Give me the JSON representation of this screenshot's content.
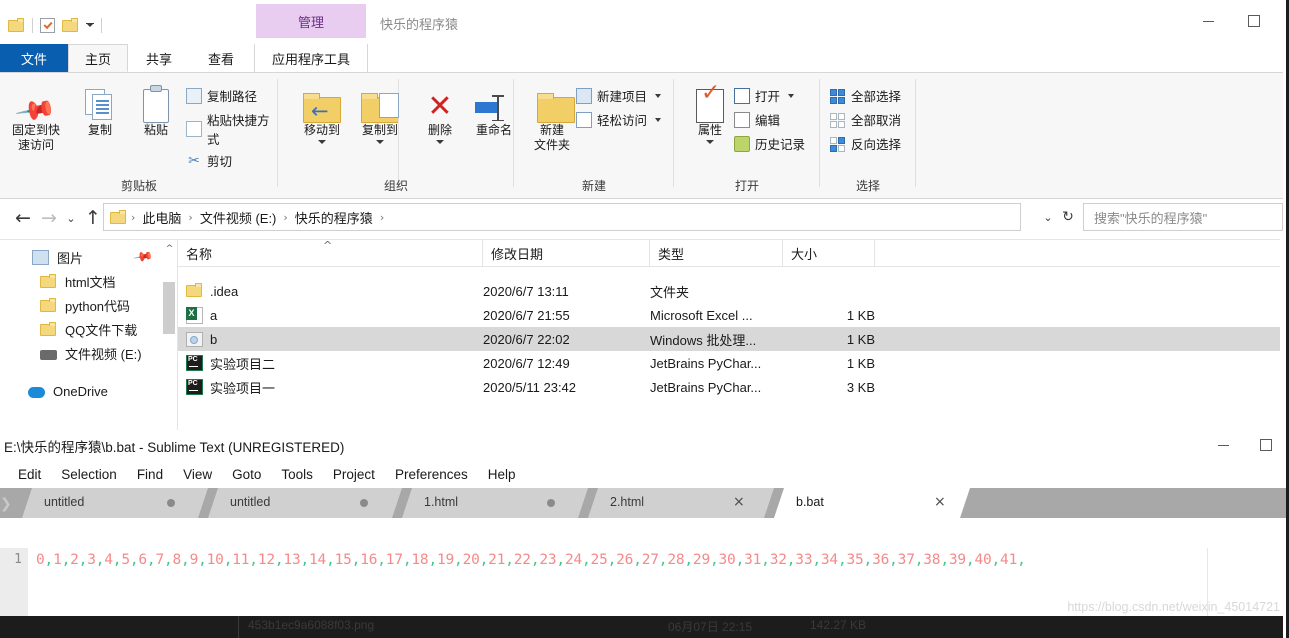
{
  "explorer": {
    "window_title": "快乐的程序猿",
    "contextual_tab": "管理",
    "quick_access": [
      "folder-icon",
      "properties-check-icon",
      "new-folder-icon",
      "customize-caret"
    ],
    "window_buttons": {
      "minimize": "minimize-icon",
      "maximize": "maximize-icon"
    },
    "ribbon_tabs": [
      {
        "label": "文件",
        "kind": "file"
      },
      {
        "label": "主页",
        "kind": "active"
      },
      {
        "label": "共享",
        "kind": "normal"
      },
      {
        "label": "查看",
        "kind": "normal"
      },
      {
        "label": "应用程序工具",
        "kind": "apptool"
      }
    ],
    "ribbon_groups": [
      {
        "label": "剪贴板",
        "big": [
          {
            "label": "固定到快\n速访问",
            "icon": "pin-icon"
          },
          {
            "label": "复制",
            "icon": "copy-icon"
          },
          {
            "label": "粘贴",
            "icon": "paste-icon"
          }
        ],
        "small": [
          {
            "label": "复制路径",
            "icon": "copy-path-icon"
          },
          {
            "label": "粘贴快捷方式",
            "icon": "paste-shortcut-icon"
          },
          {
            "label": "剪切",
            "icon": "cut-icon"
          }
        ]
      },
      {
        "label": "组织",
        "big": [
          {
            "label": "移动到",
            "icon": "move-to-icon"
          },
          {
            "label": "复制到",
            "icon": "copy-to-icon"
          },
          {
            "label": "删除",
            "icon": "delete-icon"
          },
          {
            "label": "重命名",
            "icon": "rename-icon"
          }
        ],
        "small": []
      },
      {
        "label": "新建",
        "big": [
          {
            "label": "新建\n文件夹",
            "icon": "new-folder-icon"
          }
        ],
        "small": [
          {
            "label": "新建项目",
            "icon": "new-item-icon"
          },
          {
            "label": "轻松访问",
            "icon": "easy-access-icon"
          }
        ]
      },
      {
        "label": "打开",
        "big": [
          {
            "label": "属性",
            "icon": "properties-icon"
          }
        ],
        "small": [
          {
            "label": "打开",
            "icon": "open-icon"
          },
          {
            "label": "编辑",
            "icon": "edit-icon"
          },
          {
            "label": "历史记录",
            "icon": "history-icon"
          }
        ]
      },
      {
        "label": "选择",
        "big": [],
        "small": [
          {
            "label": "全部选择",
            "icon": "select-all-icon"
          },
          {
            "label": "全部取消",
            "icon": "select-none-icon"
          },
          {
            "label": "反向选择",
            "icon": "invert-selection-icon"
          }
        ]
      }
    ],
    "address": {
      "back": "←",
      "forward": "→",
      "recent": "⌄",
      "up": "↑",
      "crumbs": [
        "此电脑",
        "文件视频 (E:)",
        "快乐的程序猿"
      ],
      "dropdown": "⌄",
      "refresh": "↻",
      "search_placeholder": "搜索\"快乐的程序猿\""
    },
    "nav_pane": [
      {
        "label": "图片",
        "icon": "pictures-icon",
        "pinned": true,
        "level": 1
      },
      {
        "label": "html文档",
        "icon": "folder-icon",
        "pinned": false,
        "level": 2
      },
      {
        "label": "python代码",
        "icon": "folder-icon",
        "pinned": false,
        "level": 2
      },
      {
        "label": "QQ文件下载",
        "icon": "folder-icon",
        "pinned": false,
        "level": 2
      },
      {
        "label": "文件视频 (E:)",
        "icon": "drive-icon",
        "pinned": false,
        "level": 2
      },
      {
        "label": "OneDrive",
        "icon": "onedrive-icon",
        "pinned": false,
        "level": 1
      }
    ],
    "columns": [
      "名称",
      "修改日期",
      "类型",
      "大小"
    ],
    "files": [
      {
        "name": ".idea",
        "date": "2020/6/7 13:11",
        "type": "文件夹",
        "size": "",
        "icon": "folder-icon",
        "selected": false
      },
      {
        "name": "a",
        "date": "2020/6/7 21:55",
        "type": "Microsoft Excel ...",
        "size": "1 KB",
        "icon": "excel-icon",
        "selected": false
      },
      {
        "name": "b",
        "date": "2020/6/7 22:02",
        "type": "Windows 批处理...",
        "size": "1 KB",
        "icon": "bat-icon",
        "selected": true
      },
      {
        "name": "实验项目二",
        "date": "2020/6/7 12:49",
        "type": "JetBrains PyChar...",
        "size": "1 KB",
        "icon": "pycharm-icon",
        "selected": false
      },
      {
        "name": "实验项目一",
        "date": "2020/5/11 23:42",
        "type": "JetBrains PyChar...",
        "size": "3 KB",
        "icon": "pycharm-icon",
        "selected": false
      }
    ]
  },
  "sublime": {
    "title": "E:\\快乐的程序猿\\b.bat - Sublime Text (UNREGISTERED)",
    "menu": [
      "Edit",
      "Selection",
      "Find",
      "View",
      "Goto",
      "Tools",
      "Project",
      "Preferences",
      "Help"
    ],
    "tabs": [
      {
        "label": "untitled",
        "modified": true,
        "active": false
      },
      {
        "label": "untitled",
        "modified": true,
        "active": false
      },
      {
        "label": "1.html",
        "modified": true,
        "active": false
      },
      {
        "label": "2.html",
        "modified": false,
        "active": false
      },
      {
        "label": "b.bat",
        "modified": false,
        "active": true
      }
    ],
    "gutter_line": "1",
    "code_line": "0,1,2,3,4,5,6,7,8,9,10,11,12,13,14,15,16,17,18,19,20,21,22,23,24,25,26,27,28,29,30,31,32,33,34,35,36,37,38,39,40,41,",
    "window_buttons": {
      "minimize": "minimize-icon",
      "maximize": "maximize-icon"
    }
  },
  "bottom_bar": {
    "filename": "453b1ec9a6088f03.png",
    "date": "06月07日 22:15",
    "filesize": "142.27 KB"
  },
  "watermark": "https://blog.csdn.net/weixin_45014721",
  "colors": {
    "file_tab": "#0a5eb0",
    "contextual_tab": "#e8cdf0",
    "contextual_text": "#6b2f86",
    "selection": "#d8d8d8",
    "number_token": "#f58a8a",
    "comma_token": "#3ec98e",
    "tab_bar": "#a8a8a8"
  }
}
